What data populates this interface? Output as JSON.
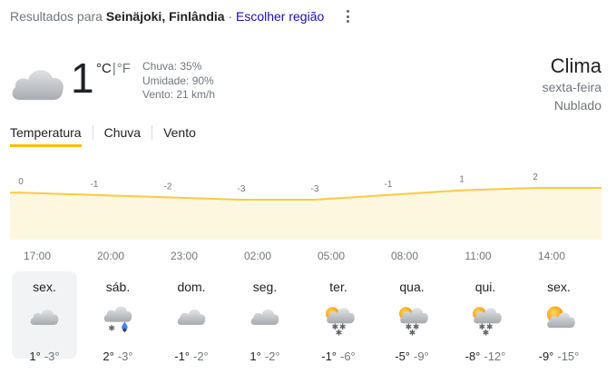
{
  "header": {
    "prefix": "Resultados para ",
    "location": "Seinäjoki, Finlândia",
    "separator": " · ",
    "change_region": "Escolher região"
  },
  "current": {
    "icon": "cloud-icon",
    "temperature": "1",
    "unit_c": "°C",
    "unit_sep": "|",
    "unit_f": "°F",
    "precip": "Chuva: 35%",
    "humidity": "Umidade: 90%",
    "wind": "Vento: 21 km/h"
  },
  "side": {
    "title": "Clima",
    "day": "sexta-feira",
    "condition": "Nublado"
  },
  "tabs": [
    {
      "label": "Temperatura",
      "active": true
    },
    {
      "label": "Chuva",
      "active": false
    },
    {
      "label": "Vento",
      "active": false
    }
  ],
  "colors": {
    "accent": "#fbbc04",
    "fill": "#fef7e0",
    "line": "#fbc943"
  },
  "chart_data": {
    "type": "area",
    "x": [
      "17:00",
      "20:00",
      "23:00",
      "02:00",
      "05:00",
      "08:00",
      "11:00",
      "14:00"
    ],
    "values": [
      0,
      -1,
      -2,
      -3,
      -3,
      -1,
      1,
      2
    ],
    "point_labels": [
      "0",
      "-1",
      "-2",
      "-3",
      "-3",
      "-1",
      "1",
      "2"
    ]
  },
  "forecast": [
    {
      "day": "sex.",
      "icon": "cloud-icon",
      "high": "1°",
      "low": "-3°",
      "selected": true
    },
    {
      "day": "sáb.",
      "icon": "snow-rain-cloud-icon",
      "high": "2°",
      "low": "-3°",
      "selected": false
    },
    {
      "day": "dom.",
      "icon": "cloud-icon",
      "high": "-1°",
      "low": "-2°",
      "selected": false
    },
    {
      "day": "seg.",
      "icon": "cloud-icon",
      "high": "1°",
      "low": "-2°",
      "selected": false
    },
    {
      "day": "ter.",
      "icon": "sun-snow-cloud-icon",
      "high": "-1°",
      "low": "-6°",
      "selected": false
    },
    {
      "day": "qua.",
      "icon": "sun-snow-cloud-icon",
      "high": "-5°",
      "low": "-9°",
      "selected": false
    },
    {
      "day": "qui.",
      "icon": "sun-snow-cloud-icon",
      "high": "-8°",
      "low": "-12°",
      "selected": false
    },
    {
      "day": "sex.",
      "icon": "partly-cloudy-icon",
      "high": "-9°",
      "low": "-15°",
      "selected": false
    }
  ]
}
